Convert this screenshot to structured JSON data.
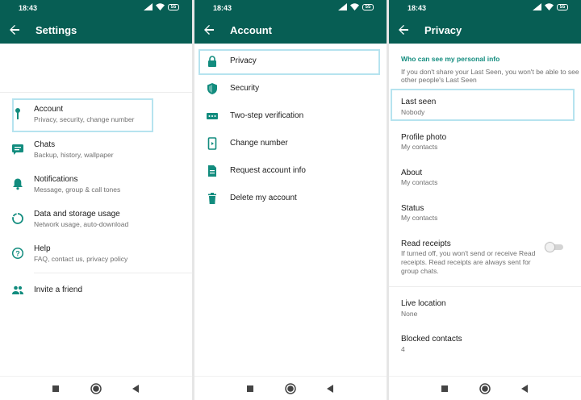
{
  "status_bar": {
    "time": "18:43",
    "battery": "55"
  },
  "settings_screen": {
    "title": "Settings",
    "items": [
      {
        "label": "Account",
        "subtitle": "Privacy, security, change number",
        "icon": "key-icon"
      },
      {
        "label": "Chats",
        "subtitle": "Backup, history, wallpaper",
        "icon": "chat-icon"
      },
      {
        "label": "Notifications",
        "subtitle": "Message, group & call tones",
        "icon": "bell-icon"
      },
      {
        "label": "Data and storage usage",
        "subtitle": "Network usage, auto-download",
        "icon": "data-usage-icon"
      },
      {
        "label": "Help",
        "subtitle": "FAQ, contact us, privacy policy",
        "icon": "help-icon"
      }
    ],
    "invite": {
      "label": "Invite a friend",
      "icon": "people-icon"
    }
  },
  "account_screen": {
    "title": "Account",
    "items": [
      {
        "label": "Privacy",
        "icon": "lock-icon"
      },
      {
        "label": "Security",
        "icon": "shield-icon"
      },
      {
        "label": "Two-step verification",
        "icon": "dots-icon"
      },
      {
        "label": "Change number",
        "icon": "phone-change-icon"
      },
      {
        "label": "Request account info",
        "icon": "document-icon"
      },
      {
        "label": "Delete my account",
        "icon": "trash-icon"
      }
    ]
  },
  "privacy_screen": {
    "title": "Privacy",
    "section_title": "Who can see my personal info",
    "section_desc_1": "If you don't share your Last Seen, you won't be able to see",
    "section_desc_2": "other people's Last Seen",
    "items": [
      {
        "label": "Last seen",
        "value": "Nobody"
      },
      {
        "label": "Profile photo",
        "value": "My contacts"
      },
      {
        "label": "About",
        "value": "My contacts"
      },
      {
        "label": "Status",
        "value": "My contacts"
      }
    ],
    "read_receipts": {
      "label": "Read receipts",
      "desc_1": "If turned off, you won't send or receive Read",
      "desc_2": "receipts. Read receipts are always sent for",
      "desc_3": "group chats.",
      "enabled": false
    },
    "live_location": {
      "label": "Live location",
      "value": "None"
    },
    "blocked": {
      "label": "Blocked contacts",
      "value": "4"
    }
  },
  "colors": {
    "header": "#075e54",
    "icon": "#128c7e",
    "accent": "#128c7e",
    "highlight": "#b6e3ef"
  }
}
